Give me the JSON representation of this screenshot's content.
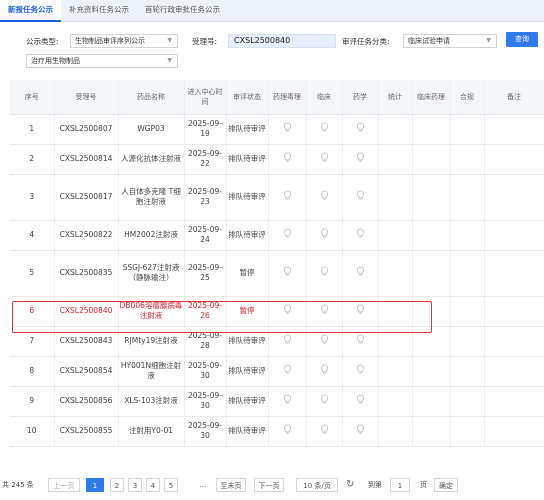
{
  "tabs": [
    "新报任务公示",
    "补充资料任务公示",
    "首轮行政审批任务公示"
  ],
  "filters": {
    "type_label": "公示类型:",
    "type_value": "生物制品审评序列公示",
    "accept_label": "受理号:",
    "accept_value": "CXSL2500840",
    "task_label": "审评任务分类:",
    "task_value": "临床试验申请",
    "category_value": "治疗用生物制品",
    "search_label": "查询"
  },
  "columns": [
    "序号",
    "受理号",
    "药品名称",
    "进入中心时间",
    "审评状态",
    "药理毒理",
    "临床",
    "药学",
    "统计",
    "临床药理",
    "合规",
    "备注"
  ],
  "rows": [
    {
      "no": "1",
      "id": "CXSL2500807",
      "name": "WGP03",
      "date": "2025-09-19",
      "status": "排队待审评"
    },
    {
      "no": "2",
      "id": "CXSL2500814",
      "name": "人源化抗体注射液",
      "date": "2025-09-22",
      "status": "排队待审评"
    },
    {
      "no": "3",
      "id": "CXSL2500817",
      "name": "人自体多克隆 T细胞注射液",
      "date": "2025-09-23",
      "status": "排队待审评"
    },
    {
      "no": "4",
      "id": "CXSL2500822",
      "name": "HM2002注射液",
      "date": "2025-09-24",
      "status": "排队待审评"
    },
    {
      "no": "5",
      "id": "CXSL2500835",
      "name": "SSGJ-627注射液（静脉输注）",
      "date": "2025-09-25",
      "status": "暂停"
    },
    {
      "no": "6",
      "id": "CXSL2500840",
      "name": "DB006溶瘤腺病毒注射液",
      "date": "2025-09-26",
      "status": "暂停"
    },
    {
      "no": "7",
      "id": "CXSL2500843",
      "name": "RJMty19注射液",
      "date": "2025-09-28",
      "status": "排队待审评"
    },
    {
      "no": "8",
      "id": "CXSL2500854",
      "name": "HY001N细胞注射液",
      "date": "2025-09-30",
      "status": "排队待审评"
    },
    {
      "no": "9",
      "id": "CXSL2500856",
      "name": "XLS-103注射液",
      "date": "2025-09-30",
      "status": "排队待审评"
    },
    {
      "no": "10",
      "id": "CXSL2500855",
      "name": "注射用Y0-01",
      "date": "2025-09-30",
      "status": "排队待审评"
    }
  ],
  "highlight_row": 6,
  "pager": {
    "total": "共 245 条",
    "prev": "上一页",
    "pages": [
      "1",
      "2",
      "3",
      "4",
      "5"
    ],
    "ellipsis": "...",
    "last": "至末页",
    "next": "下一页",
    "per_page": "10 条/页",
    "goto_label": "到第",
    "goto_value": "1",
    "page_unit": "页",
    "confirm": "确定"
  },
  "colors": {
    "accent": "#2f7bec",
    "highlight": "#e0363c",
    "bulb": "#b8bcc4"
  }
}
